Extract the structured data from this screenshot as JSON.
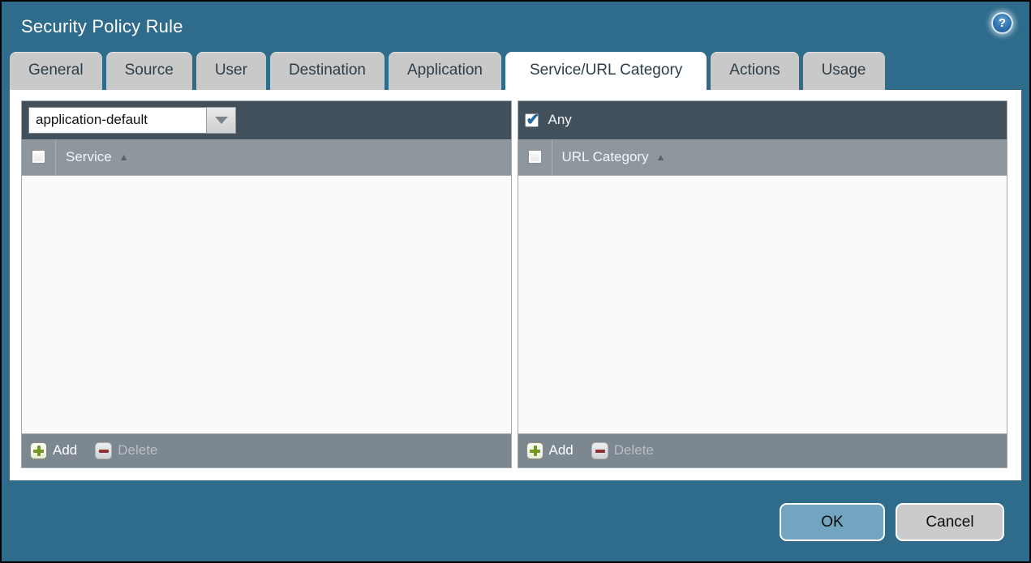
{
  "dialog": {
    "title": "Security Policy Rule"
  },
  "help": {
    "glyph": "?"
  },
  "tabs": [
    {
      "label": "General",
      "active": false
    },
    {
      "label": "Source",
      "active": false
    },
    {
      "label": "User",
      "active": false
    },
    {
      "label": "Destination",
      "active": false
    },
    {
      "label": "Application",
      "active": false
    },
    {
      "label": "Service/URL Category",
      "active": true
    },
    {
      "label": "Actions",
      "active": false
    },
    {
      "label": "Usage",
      "active": false
    }
  ],
  "left_panel": {
    "dropdown_value": "application-default",
    "column_header": "Service",
    "sort_arrow": "▲",
    "add_label": "Add",
    "delete_label": "Delete",
    "delete_enabled": false,
    "rows": []
  },
  "right_panel": {
    "any_label": "Any",
    "any_checked": true,
    "column_header": "URL Category",
    "sort_arrow": "▲",
    "add_label": "Add",
    "delete_label": "Delete",
    "delete_enabled": false,
    "rows": []
  },
  "footer": {
    "ok_label": "OK",
    "cancel_label": "Cancel"
  },
  "colors": {
    "dialog_background": "#2f6b8b",
    "toolbar_dark": "#41505a",
    "column_header_gray": "#8e979e",
    "footer_bar_gray": "#7d8790",
    "tab_inactive": "#c9c9c9",
    "tab_active": "#ffffff",
    "ok_button": "#72a6c0",
    "cancel_button": "#cacbcc",
    "check_blue": "#27699c",
    "add_green": "#6f9a1f",
    "delete_red": "#8e3038"
  }
}
